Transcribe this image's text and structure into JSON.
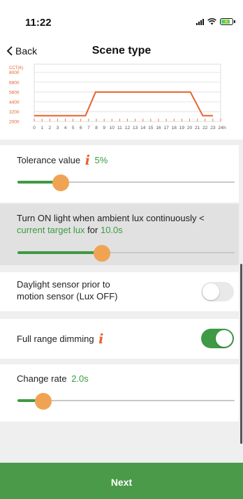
{
  "status_bar": {
    "time": "11:22"
  },
  "nav": {
    "back_label": "Back",
    "title": "Scene type"
  },
  "cct_chart": {
    "chart_data": {
      "type": "line",
      "ylabel": "CCT(K)",
      "yticks": [
        2000,
        3200,
        4400,
        5600,
        6800,
        8000
      ],
      "ylim": [
        2000,
        9000
      ],
      "xticks": [
        "0",
        "1",
        "2",
        "3",
        "4",
        "5",
        "6",
        "7",
        "8",
        "9",
        "10",
        "11",
        "12",
        "13",
        "14",
        "15",
        "16",
        "17",
        "18",
        "19",
        "20",
        "21",
        "22",
        "23",
        "24"
      ],
      "x_unit": "h",
      "xlim": [
        0,
        24
      ],
      "series": [
        {
          "x": [
            0,
            6.6,
            7.9,
            20.1,
            21.7,
            23
          ],
          "y": [
            2700,
            2700,
            5600,
            5600,
            2700,
            2700
          ]
        }
      ],
      "colors": {
        "line": "#e8612c",
        "axis_text": "#e8612c",
        "tick_text": "#555555",
        "grid": "#dddddd"
      }
    }
  },
  "tolerance": {
    "label": "Tolerance value",
    "value_text": "5%",
    "slider_fraction": 0.2
  },
  "ambient": {
    "label_prefix": "Turn ON light when ambient lux continuously <",
    "target_text": "current target lux",
    "for_text": "for",
    "duration_text": "10.0s",
    "slider_fraction": 0.39
  },
  "daylight": {
    "label_line1": "Daylight sensor prior to",
    "label_line2": "motion sensor (Lux OFF)",
    "toggle_state": "off"
  },
  "full_range": {
    "label": "Full range dimming",
    "toggle_state": "on"
  },
  "change_rate": {
    "label": "Change rate",
    "value_text": "2.0s",
    "slider_fraction": 0.12
  },
  "footer": {
    "next_label": "Next"
  },
  "colors": {
    "accent_green": "#3e9a44",
    "slider_thumb": "#f0a453",
    "info_icon": "#e8612c",
    "next_button": "#4a9a4a"
  }
}
